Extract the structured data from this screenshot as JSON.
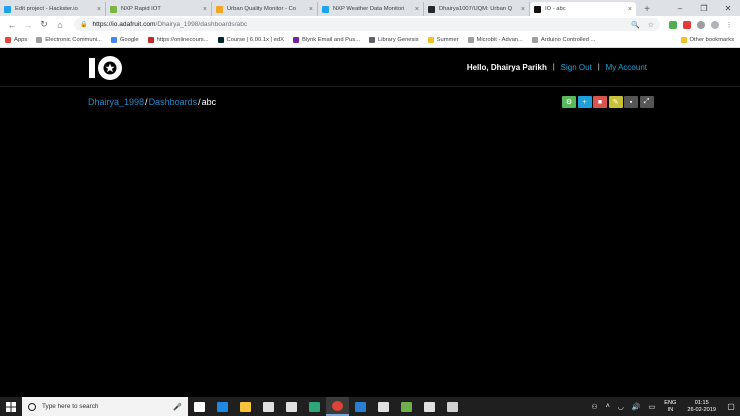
{
  "browser": {
    "tabs": [
      {
        "title": "Edit project - Hackster.io",
        "favicon_color": "#1da1f2",
        "active": false
      },
      {
        "title": "NXP Rapid IOT",
        "favicon_color": "#7cb342",
        "active": false
      },
      {
        "title": "Urban Quality Monitor - Co",
        "favicon_color": "#f5a623",
        "active": false
      },
      {
        "title": "NXP Weather Data Monitori",
        "favicon_color": "#1da1f2",
        "active": false
      },
      {
        "title": "Dhairya1007/UQM: Urban Q",
        "favicon_color": "#24292e",
        "active": false
      },
      {
        "title": "IO - abc",
        "favicon_color": "#111111",
        "active": true
      }
    ],
    "new_tab_symbol": "+",
    "close_symbol": "×",
    "window_controls": [
      "–",
      "❐",
      "✕"
    ],
    "address": {
      "host": "https://io.adafruit.com",
      "path": "/Dhairya_1998/dashboards/abc"
    },
    "bookmarks": [
      {
        "label": "Apps",
        "color": "#e8453c"
      },
      {
        "label": "Electronic Communi...",
        "color": "#9e9e9e"
      },
      {
        "label": "Google",
        "color": "#4285f4"
      },
      {
        "label": "https://onlinecours...",
        "color": "#c62828"
      },
      {
        "label": "Course | 6.00.1x | edX",
        "color": "#02262b"
      },
      {
        "label": "Blynk Email and Pus...",
        "color": "#7b1fa2"
      },
      {
        "label": "Library Genesis",
        "color": "#5f6368"
      },
      {
        "label": "Summer",
        "color": "#f6bf26"
      },
      {
        "label": "Microbit - Advan...",
        "color": "#9e9e9e"
      },
      {
        "label": "Arduino Controlled ...",
        "color": "#9e9e9e"
      }
    ],
    "other_bookmarks": "Other bookmarks"
  },
  "page": {
    "nav": {
      "greeting": "Hello, Dhairya Parikh",
      "sign_out": "Sign Out",
      "my_account": "My Account",
      "separator": "|"
    },
    "breadcrumb": {
      "user": "Dhairya_1998",
      "section": "Dashboards",
      "current": "abc",
      "separator": "/"
    },
    "toolbar": [
      {
        "name": "settings-icon",
        "color": "#5cb85c",
        "glyph": "⚙"
      },
      {
        "name": "plus-icon",
        "color": "#1fa0d8",
        "glyph": "+"
      },
      {
        "name": "trash-icon",
        "color": "#d9534f",
        "glyph": "■"
      },
      {
        "name": "key-icon",
        "color": "#c7c13a",
        "glyph": "✎"
      },
      {
        "name": "lock-icon",
        "color": "#555555",
        "glyph": "▪"
      },
      {
        "name": "expand-icon",
        "color": "#555555",
        "glyph": "⤢"
      }
    ]
  },
  "taskbar": {
    "search_placeholder": "Type here to search",
    "apps": [
      {
        "name": "task-view-icon",
        "color": "#ffffff"
      },
      {
        "name": "edge-icon",
        "color": "#1e88e5"
      },
      {
        "name": "file-explorer-icon",
        "color": "#f9c23c"
      },
      {
        "name": "store-icon",
        "color": "#e0e0e0"
      },
      {
        "name": "mail-icon",
        "color": "#e0e0e0"
      },
      {
        "name": "app-icon",
        "color": "#2fa67a"
      },
      {
        "name": "chrome-icon",
        "color": "#db4437"
      },
      {
        "name": "vscode-icon",
        "color": "#2a7fd0"
      },
      {
        "name": "settings-app-icon",
        "color": "#e0e0e0"
      },
      {
        "name": "notepad-icon",
        "color": "#6fb04c"
      },
      {
        "name": "photos-icon",
        "color": "#e0e0e0"
      },
      {
        "name": "paint-icon",
        "color": "#d0d0d0"
      }
    ],
    "active_app": 6,
    "lang_top": "ENG",
    "lang_bottom": "IN",
    "time": "01:15",
    "date": "26-02-2019"
  }
}
